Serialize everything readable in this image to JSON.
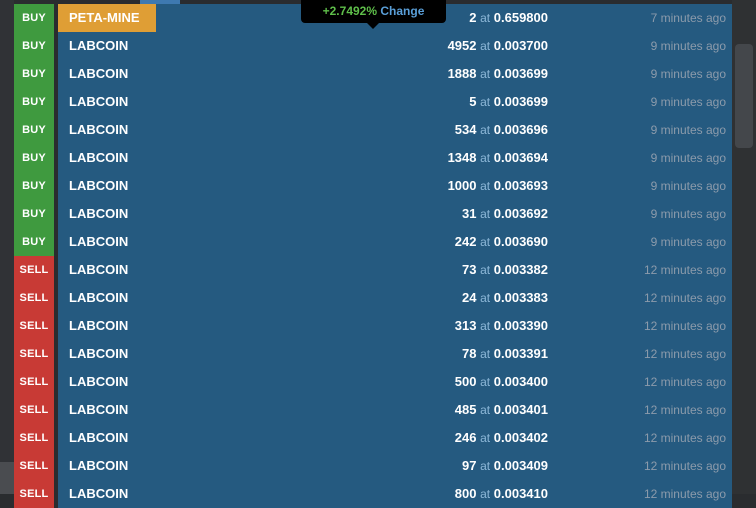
{
  "tooltip": {
    "percent": "+2.7492%",
    "label": "Change"
  },
  "at_label": "at",
  "trades": [
    {
      "side": "BUY",
      "coin": "PETA-MINE",
      "qty": "2",
      "price": "0.659800",
      "time": "7 minutes ago"
    },
    {
      "side": "BUY",
      "coin": "LABCOIN",
      "qty": "4952",
      "price": "0.003700",
      "time": "9 minutes ago"
    },
    {
      "side": "BUY",
      "coin": "LABCOIN",
      "qty": "1888",
      "price": "0.003699",
      "time": "9 minutes ago"
    },
    {
      "side": "BUY",
      "coin": "LABCOIN",
      "qty": "5",
      "price": "0.003699",
      "time": "9 minutes ago"
    },
    {
      "side": "BUY",
      "coin": "LABCOIN",
      "qty": "534",
      "price": "0.003696",
      "time": "9 minutes ago"
    },
    {
      "side": "BUY",
      "coin": "LABCOIN",
      "qty": "1348",
      "price": "0.003694",
      "time": "9 minutes ago"
    },
    {
      "side": "BUY",
      "coin": "LABCOIN",
      "qty": "1000",
      "price": "0.003693",
      "time": "9 minutes ago"
    },
    {
      "side": "BUY",
      "coin": "LABCOIN",
      "qty": "31",
      "price": "0.003692",
      "time": "9 minutes ago"
    },
    {
      "side": "BUY",
      "coin": "LABCOIN",
      "qty": "242",
      "price": "0.003690",
      "time": "9 minutes ago"
    },
    {
      "side": "SELL",
      "coin": "LABCOIN",
      "qty": "73",
      "price": "0.003382",
      "time": "12 minutes ago"
    },
    {
      "side": "SELL",
      "coin": "LABCOIN",
      "qty": "24",
      "price": "0.003383",
      "time": "12 minutes ago"
    },
    {
      "side": "SELL",
      "coin": "LABCOIN",
      "qty": "313",
      "price": "0.003390",
      "time": "12 minutes ago"
    },
    {
      "side": "SELL",
      "coin": "LABCOIN",
      "qty": "78",
      "price": "0.003391",
      "time": "12 minutes ago"
    },
    {
      "side": "SELL",
      "coin": "LABCOIN",
      "qty": "500",
      "price": "0.003400",
      "time": "12 minutes ago"
    },
    {
      "side": "SELL",
      "coin": "LABCOIN",
      "qty": "485",
      "price": "0.003401",
      "time": "12 minutes ago"
    },
    {
      "side": "SELL",
      "coin": "LABCOIN",
      "qty": "246",
      "price": "0.003402",
      "time": "12 minutes ago"
    },
    {
      "side": "SELL",
      "coin": "LABCOIN",
      "qty": "97",
      "price": "0.003409",
      "time": "12 minutes ago"
    },
    {
      "side": "SELL",
      "coin": "LABCOIN",
      "qty": "800",
      "price": "0.003410",
      "time": "12 minutes ago"
    }
  ]
}
